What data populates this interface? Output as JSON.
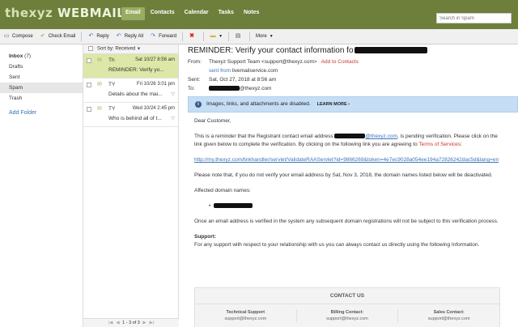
{
  "app": {
    "logo_main": "thexyz",
    "logo_sub": "WEBMAIL",
    "nav": [
      "Email",
      "Contacts",
      "Calendar",
      "Tasks",
      "Notes"
    ],
    "nav_active_index": 0,
    "search_placeholder": "Search in Spam"
  },
  "toolbar": {
    "compose": "Compose",
    "check": "Check Email",
    "reply": "Reply",
    "reply_all": "Reply All",
    "forward": "Forward",
    "more": "More"
  },
  "sidebar": {
    "items": [
      {
        "label": "Inbox",
        "count": "(7)"
      },
      {
        "label": "Drafts"
      },
      {
        "label": "Sent"
      },
      {
        "label": "Spam"
      },
      {
        "label": "Trash"
      }
    ],
    "add_folder": "Add Folder"
  },
  "list": {
    "sort_label": "Sort by: Received",
    "messages": [
      {
        "from": "Th",
        "date": "Sat 10/27 8:56 am",
        "subject": "REMINDER: Verify yo..."
      },
      {
        "from": "TY",
        "date": "Fri 10/26 3:01 pm",
        "subject": "Details about the mai..."
      },
      {
        "from": "TY",
        "date": "Wed 10/24 2:45 pm",
        "subject": "Who is behind all of t..."
      }
    ],
    "pager": "1 - 3 of 3"
  },
  "message": {
    "subject": "REMINDER: Verify your contact information fo",
    "from_label": "From:",
    "from_value": "Thexyz Support Team <support@thexyz.com>",
    "add_contacts": "Add to Contacts",
    "sent_from_label": "sent from",
    "sent_from_value": "livemailservice.com",
    "sent_label": "Sent:",
    "sent_value": "Sat, Oct 27, 2018 at 8:56 am",
    "to_label": "To:",
    "to_value": "@thexyz.com",
    "banner_text": "Images, links, and attachments are disabled.",
    "banner_link": "LEARN MORE",
    "greeting": "Dear Customer,",
    "p1_a": "This is a reminder that the Registrant contact email address ",
    "p1_email": "@thexyz.com",
    "p1_b": ", is pending verification. Please click on the link given below to complete the verification. By clicking on the following link you are agreeing to ",
    "p1_terms": "Terms of Services",
    "p1_c": ":",
    "link": "http://my.thexyz.com/linkhandler/servlet/ValidateRAAServlet?id=9866269&token=4e7ec9028a054ee194a72826242dac5d&lang=en",
    "p2": "Please note that, if you do not verify your email address by Sat, Nov 3, 2018, the domain names listed below will be deactivated.",
    "p3": "Affected domain names:",
    "p4": "Once an email address is verified in the system any subsequent domain registrations will not be subject to this verification process.",
    "support_title": "Support:",
    "support_text": "For any support with respect to your relationship with us you can always contact us directly using the following Information.",
    "contact_title": "CONTACT US",
    "contacts": [
      {
        "h": "Technical Support",
        "v": "support@thexyz.com"
      },
      {
        "h": "Billing Contact:",
        "v": "support@thexyz.com"
      },
      {
        "h": "Sales Contact:",
        "v": "support@thexyz.com"
      }
    ]
  },
  "colors": {
    "topbar": "#6d7f3b",
    "nav_active": "#9aac62",
    "selected_row": "#dde7a7",
    "banner": "#c5def5",
    "link": "#3b73b9",
    "red": "#cc3333"
  }
}
